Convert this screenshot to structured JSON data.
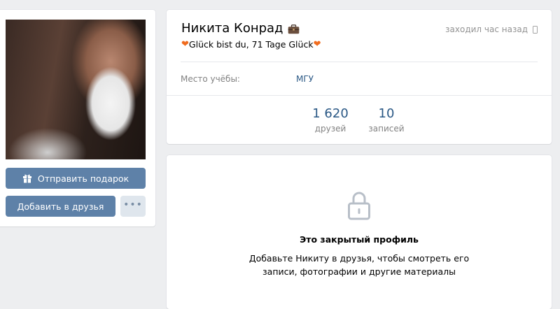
{
  "profile": {
    "name": "Никита Конрад",
    "last_seen": "заходил час назад",
    "status_text": "Glück bist du, 71 Tage Glück",
    "info": {
      "label": "Место учёбы:",
      "value": "МГУ"
    },
    "counters": [
      {
        "number": "1 620",
        "label": "друзей"
      },
      {
        "number": "10",
        "label": "записей"
      }
    ]
  },
  "actions": {
    "gift_label": "Отправить подарок",
    "add_friend_label": "Добавить в друзья",
    "more_label": "•••"
  },
  "closed": {
    "title": "Это закрытый профиль",
    "description": "Добавьте Никиту в друзья, чтобы смотреть его записи, фотографии и другие материалы"
  },
  "icons": {
    "gift": "gift-icon",
    "briefcase": "briefcase-icon",
    "phone": "mobile-phone-icon",
    "heart": "heart-icon",
    "lock": "lock-icon"
  },
  "colors": {
    "page_bg": "#edeef0",
    "button_primary": "#5e81a8",
    "button_secondary": "#dfe6ed",
    "link": "#2a5885",
    "heart": "#f06b1d"
  }
}
